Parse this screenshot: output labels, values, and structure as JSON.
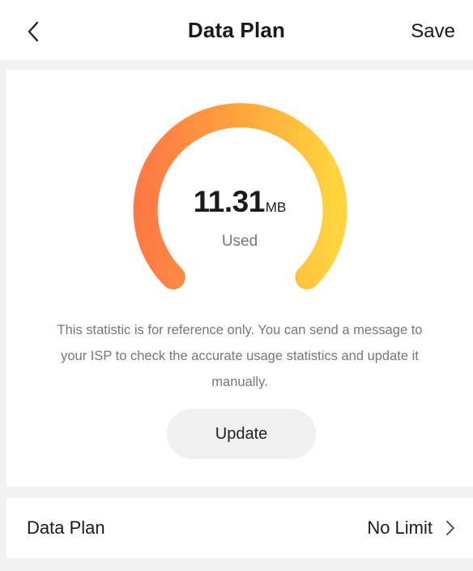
{
  "header": {
    "title": "Data Plan",
    "save_label": "Save",
    "back_icon": "chevron-left-icon"
  },
  "usage": {
    "value": "11.31",
    "unit": "MB",
    "label": "Used",
    "gauge_colors": [
      "#ff7a45",
      "#ffa53a",
      "#ffd43f"
    ]
  },
  "notice": "This statistic is for reference only. You can send a message to your ISP to check the accurate usage statistics and update it manually.",
  "update_label": "Update",
  "plan_row": {
    "label": "Data Plan",
    "value": "No Limit",
    "chevron_icon": "chevron-right-icon"
  }
}
